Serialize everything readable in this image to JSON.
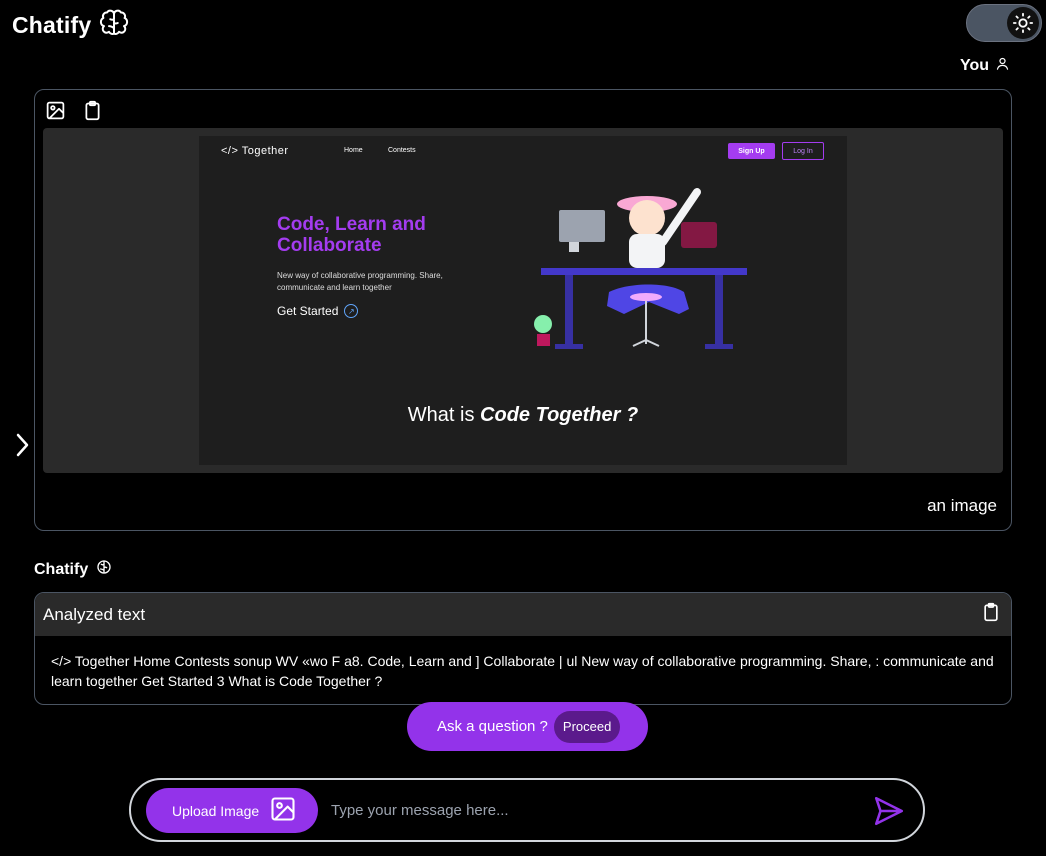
{
  "header": {
    "title": "Chatify",
    "brain_icon": "brain-icon",
    "theme_icon": "sun-icon"
  },
  "user_message": {
    "sender": "You",
    "caption": "an image",
    "preview": {
      "logo": "</> Together",
      "nav": [
        "Home",
        "Contests"
      ],
      "signup": "Sign Up",
      "login": "Log In",
      "headline": "Code, Learn and Collaborate",
      "tagline": "New way of collaborative programming. Share, communicate and learn together",
      "cta": "Get Started",
      "what_prefix": "What is ",
      "what_emph": "Code Together ?"
    }
  },
  "bot_message": {
    "sender": "Chatify",
    "header_title": "Analyzed text",
    "text": "</> Together Home Contests sonup WV «wo F a8. Code, Learn and ] Collaborate | ul New way of collaborative programming. Share, : communicate and learn together Get Started 3 What is Code Together ?"
  },
  "ask": {
    "label": "Ask a question ?",
    "proceed": "Proceed"
  },
  "composer": {
    "upload_label": "Upload Image",
    "placeholder": "Type your message here..."
  },
  "colors": {
    "accent": "#9333ea",
    "card_border": "#4b5563",
    "panel": "#2a2a2a"
  }
}
